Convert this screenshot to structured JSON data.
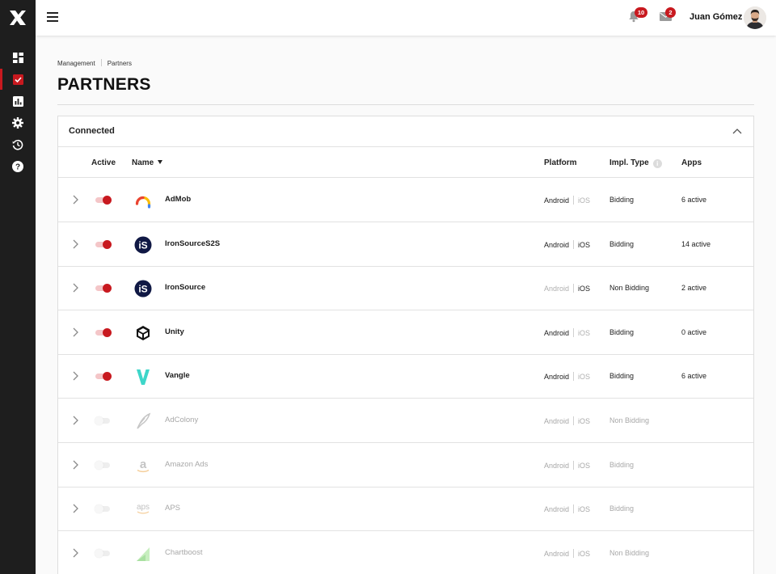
{
  "header": {
    "notifications_count": "10",
    "messages_count": "2",
    "user_name": "Juan Gómez"
  },
  "breadcrumb": [
    "Management",
    "Partners"
  ],
  "page_title": "PARTNERS",
  "panel": {
    "title": "Connected",
    "columns": {
      "active": "Active",
      "name": "Name",
      "platform": "Platform",
      "impl_type": "Impl. Type",
      "apps": "Apps"
    }
  },
  "sidebar": {
    "items": [
      "dashboard-icon",
      "partners-icon",
      "reports-icon",
      "settings-icon",
      "history-icon",
      "help-icon"
    ],
    "active_item": "partners-icon"
  },
  "colors": {
    "accent": "#c8191f",
    "sidebar": "#1e1e1e"
  },
  "partners": [
    {
      "name": "AdMob",
      "active": true,
      "android": "Android",
      "ios": "iOS",
      "android_on": true,
      "ios_on": false,
      "impl": "Bidding",
      "apps": "6 active",
      "logo": "admob-logo"
    },
    {
      "name": "IronSourceS2S",
      "active": true,
      "android": "Android",
      "ios": "iOS",
      "android_on": true,
      "ios_on": true,
      "impl": "Bidding",
      "apps": "14 active",
      "logo": "ironsource-logo"
    },
    {
      "name": "IronSource",
      "active": true,
      "android": "Android",
      "ios": "iOS",
      "android_on": false,
      "ios_on": true,
      "impl": "Non Bidding",
      "apps": "2 active",
      "logo": "ironsource-logo"
    },
    {
      "name": "Unity",
      "active": true,
      "android": "Android",
      "ios": "iOS",
      "android_on": true,
      "ios_on": false,
      "impl": "Bidding",
      "apps": "0 active",
      "logo": "unity-logo"
    },
    {
      "name": "Vangle",
      "active": true,
      "android": "Android",
      "ios": "iOS",
      "android_on": true,
      "ios_on": false,
      "impl": "Bidding",
      "apps": "6 active",
      "logo": "vangle-logo"
    },
    {
      "name": "AdColony",
      "active": false,
      "android": "Android",
      "ios": "iOS",
      "android_on": true,
      "ios_on": true,
      "impl": "Non Bidding",
      "apps": "",
      "logo": "adcolony-logo"
    },
    {
      "name": "Amazon Ads",
      "active": false,
      "android": "Android",
      "ios": "iOS",
      "android_on": true,
      "ios_on": true,
      "impl": "Bidding",
      "apps": "",
      "logo": "amazon-logo"
    },
    {
      "name": "APS",
      "active": false,
      "android": "Android",
      "ios": "iOS",
      "android_on": true,
      "ios_on": true,
      "impl": "Bidding",
      "apps": "",
      "logo": "aps-logo"
    },
    {
      "name": "Chartboost",
      "active": false,
      "android": "Android",
      "ios": "iOS",
      "android_on": true,
      "ios_on": true,
      "impl": "Non Bidding",
      "apps": "",
      "logo": "chartboost-logo"
    }
  ]
}
